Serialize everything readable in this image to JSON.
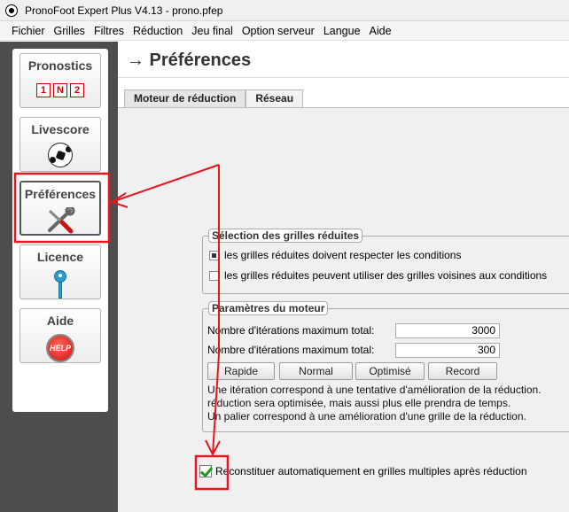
{
  "window": {
    "title": "PronoFoot Expert Plus V4.13 - prono.pfep"
  },
  "menu": [
    "Fichier",
    "Grilles",
    "Filtres",
    "Réduction",
    "Jeu final",
    "Option serveur",
    "Langue",
    "Aide"
  ],
  "sidebar": {
    "items": [
      {
        "label": "Pronostics",
        "icon": "1n2-boxes-icon",
        "boxes": [
          "1",
          "N",
          "2"
        ]
      },
      {
        "label": "Livescore",
        "icon": "soccer-ball-icon"
      },
      {
        "label": "Préférences",
        "icon": "tools-icon",
        "active": true
      },
      {
        "label": "Licence",
        "icon": "key-icon"
      },
      {
        "label": "Aide",
        "icon": "help-icon",
        "icon_text": "HELP"
      }
    ]
  },
  "main": {
    "title": "→ Préférences",
    "tabs": [
      {
        "label": "Moteur de réduction",
        "active": true
      },
      {
        "label": "Réseau"
      }
    ],
    "selection_group": {
      "title": "Sélection des grilles réduites",
      "options": [
        {
          "label": "les grilles réduites doivent respecter les conditions",
          "checked": true
        },
        {
          "label": "les grilles réduites peuvent utiliser des grilles voisines aux conditions",
          "checked": false
        }
      ]
    },
    "engine_group": {
      "title": "Paramètres du moteur",
      "fields": [
        {
          "label": "Nombre d'itérations maximum total:",
          "value": "3000"
        },
        {
          "label": "Nombre d'itérations maximum total:",
          "value": "300"
        }
      ],
      "presets": [
        "Rapide",
        "Normal",
        "Optimisé",
        "Record"
      ],
      "info": [
        "Une itération correspond à une tentative d'amélioration de la réduction.",
        "réduction sera optimisée, mais aussi plus elle prendra de temps.",
        "Un palier correspond à une amélioration d'une grille de la réduction."
      ]
    },
    "auto_rebuild": {
      "label": "Reconstituer automatiquement en grilles multiples après réduction",
      "checked": true
    }
  },
  "annotation_color": "#e8141e"
}
